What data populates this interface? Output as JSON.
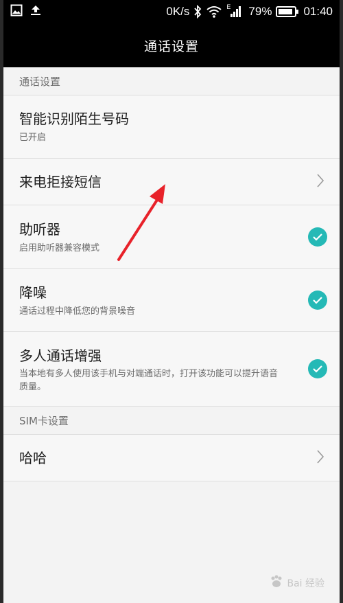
{
  "status_bar": {
    "net_speed": "0K/s",
    "signal_label": "E",
    "battery": "79%",
    "time": "01:40"
  },
  "title_bar": {
    "title": "通话设置"
  },
  "sections": [
    {
      "header": "通话设置",
      "rows": [
        {
          "title": "智能识别陌生号码",
          "subtitle": "已开启",
          "control": "none"
        },
        {
          "title": "来电拒接短信",
          "subtitle": "",
          "control": "chevron"
        },
        {
          "title": "助听器",
          "subtitle": "启用助听器兼容模式",
          "control": "checked"
        },
        {
          "title": "降噪",
          "subtitle": "通话过程中降低您的背景噪音",
          "control": "checked"
        },
        {
          "title": "多人通话增强",
          "subtitle": "当本地有多人使用该手机与对端通话时，打开该功能可以提升语音质量。",
          "control": "checked"
        }
      ]
    },
    {
      "header": "SIM卡设置",
      "rows": [
        {
          "title": "哈哈",
          "subtitle": "",
          "control": "chevron"
        }
      ]
    }
  ],
  "watermark": {
    "text": "Bai 经验"
  },
  "colors": {
    "accent": "#25b9b6",
    "annotation": "#e8222a"
  }
}
